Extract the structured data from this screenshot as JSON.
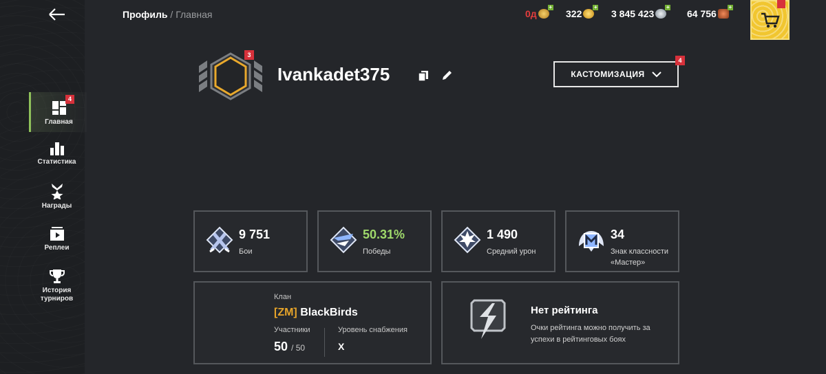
{
  "breadcrumb": {
    "parent": "Профиль",
    "separator": "/",
    "current": "Главная"
  },
  "resources": [
    {
      "value": "0д",
      "icon": "premium-icon",
      "color": "#e43d3d"
    },
    {
      "value": "322",
      "icon": "gold-icon",
      "color": "#ffffff"
    },
    {
      "value": "3 845 423",
      "icon": "silver-icon",
      "color": "#ffffff"
    },
    {
      "value": "64 756",
      "icon": "free-xp-icon",
      "color": "#ffffff"
    }
  ],
  "sidebar": {
    "items": [
      {
        "label": "Главная",
        "badge": "4",
        "icon": "home-dashboard-icon"
      },
      {
        "label": "Статистика",
        "icon": "statistics-icon"
      },
      {
        "label": "Награды",
        "icon": "awards-icon"
      },
      {
        "label": "Реплеи",
        "icon": "replays-icon"
      },
      {
        "label": "История турниров",
        "icon": "trophy-icon"
      }
    ]
  },
  "profile": {
    "username": "Ivankadet375",
    "rank_badge": "3",
    "customize_label": "КАСТОМИЗАЦИЯ",
    "customize_badge": "4"
  },
  "stats": [
    {
      "value": "9 751",
      "label": "Бои",
      "icon": "battles-icon",
      "color": "#ffffff"
    },
    {
      "value": "50.31%",
      "label": "Победы",
      "icon": "victories-icon",
      "color": "#9fd96b"
    },
    {
      "value": "1 490",
      "label": "Средний урон",
      "icon": "avg-damage-icon",
      "color": "#ffffff"
    },
    {
      "value": "34",
      "label": "Знак классности «Мастер»",
      "icon": "mastery-badge-icon",
      "color": "#ffffff"
    }
  ],
  "clan": {
    "label": "Клан",
    "tag": "[ZM]",
    "name": "BlackBirds",
    "members_label": "Участники",
    "members": "50",
    "members_max": "/ 50",
    "supply_label": "Уровень снабжения",
    "supply_value": "X"
  },
  "rating": {
    "title": "Нет рейтинга",
    "description": "Очки рейтинга можно получить за успехи в рейтинговых боях"
  },
  "colors": {
    "accent_green": "#8fc15a",
    "badge_red": "#d7313b",
    "gold": "#f1c630",
    "clan_tag": "#e6a42a"
  }
}
